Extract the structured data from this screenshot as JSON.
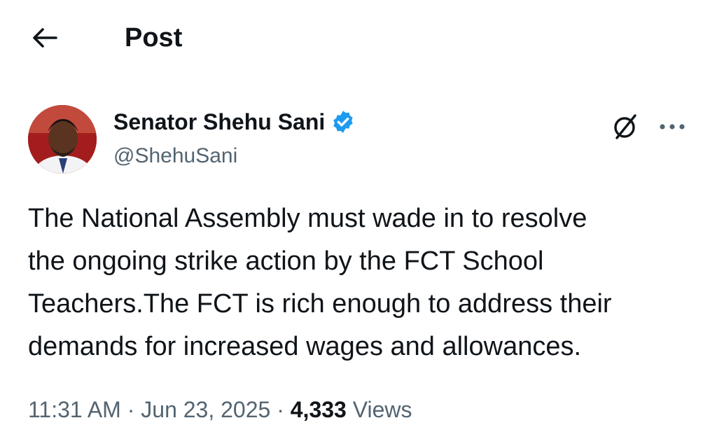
{
  "header": {
    "back_icon": "arrow-left-icon",
    "title": "Post"
  },
  "author": {
    "name": "Senator Shehu Sani",
    "handle": "@ShehuSani",
    "verified_icon": "verified-badge-icon",
    "verified_color": "#1d9bf0",
    "grok_icon": "grok-icon",
    "more_icon": "more-horizontal-icon"
  },
  "tweet": {
    "text": "The National Assembly must wade in to resolve\nthe ongoing strike action by the FCT School\nTeachers.The FCT is rich enough to address their\ndemands for increased wages and allowances."
  },
  "meta": {
    "time": "11:31 AM",
    "sep1": " · ",
    "date": "Jun 23, 2025",
    "sep2": " · ",
    "views_count": "4,333",
    "views_label": " Views"
  },
  "colors": {
    "text": "#0f1419",
    "secondary": "#536471",
    "accent": "#1d9bf0"
  }
}
